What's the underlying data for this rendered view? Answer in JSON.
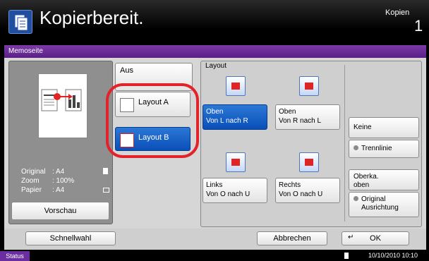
{
  "header": {
    "title": "Kopierbereit.",
    "mode": "Kopien",
    "copies": "1"
  },
  "screen": {
    "title": "Memoseite"
  },
  "preview": {
    "info": [
      {
        "key": "Original",
        "value": ": A4"
      },
      {
        "key": "Zoom",
        "value": ": 100%"
      },
      {
        "key": "Papier",
        "value": ": A4"
      }
    ],
    "button": "Vorschau"
  },
  "options": {
    "off": "Aus",
    "layout_a": "Layout A",
    "layout_b": "Layout B"
  },
  "layout": {
    "label": "Layout",
    "directions": [
      {
        "line1": "Oben",
        "line2": "Von L nach R",
        "selected": true
      },
      {
        "line1": "Oben",
        "line2": "Von R nach L",
        "selected": false
      },
      {
        "line1": "Links",
        "line2": "Von O nach U",
        "selected": false
      },
      {
        "line1": "Rechts",
        "line2": "Von O nach U",
        "selected": false
      }
    ],
    "none": "Keine",
    "separator": "Trennlinie",
    "orientation_value_1": "Oberka.",
    "orientation_value_2": "oben",
    "orientation_label_1": "Original",
    "orientation_label_2": "Ausrichtung"
  },
  "footer": {
    "quick": "Schnellwahl",
    "cancel": "Abbrechen",
    "ok": "OK"
  },
  "status": {
    "tab": "Status",
    "datetime": "10/10/2010  10:10"
  },
  "colors": {
    "accent": "#6a2ea0",
    "selected": "#0a4fb8",
    "highlight": "#e3232b"
  }
}
